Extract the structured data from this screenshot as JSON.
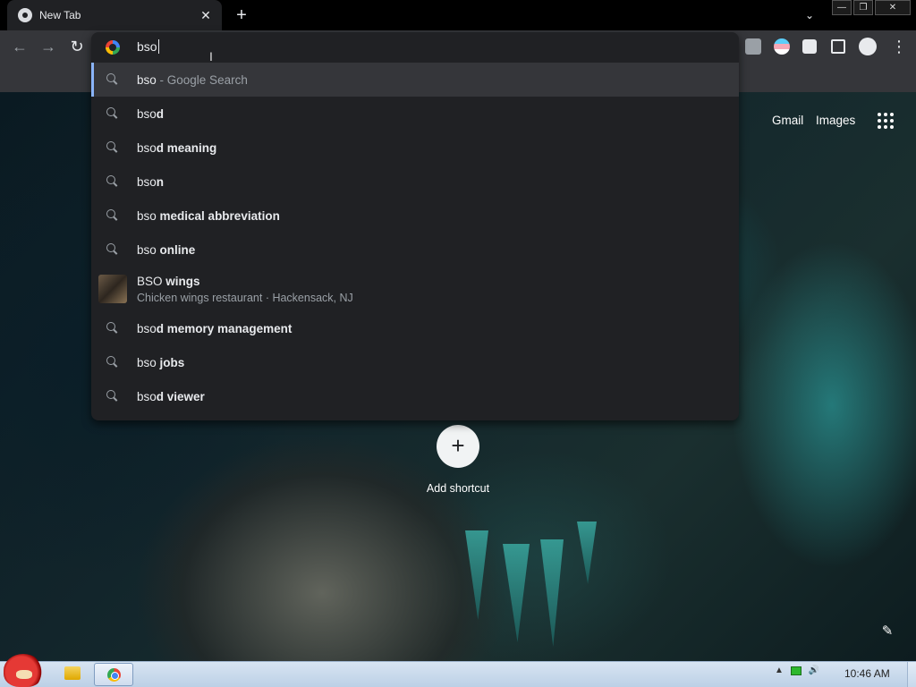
{
  "browser": {
    "tab": {
      "title": "New Tab",
      "close_glyph": "✕",
      "icon": "chrome-icon"
    },
    "new_tab_glyph": "+",
    "tab_search_glyph": "⌄",
    "window_controls": [
      "—",
      "❐",
      "✕"
    ],
    "nav": {
      "back_glyph": "←",
      "forward_glyph": "→",
      "reload_glyph": "↻"
    },
    "extensions": [
      "ublock-icon",
      "extension-avatar-icon",
      "puzzle-icon",
      "sidepanel-icon",
      "profile-icon",
      "menu-dots-icon"
    ],
    "menu_glyph": "⋮"
  },
  "omnibox": {
    "value": "bso",
    "suggestions": [
      {
        "typed": "bso",
        "rest": "",
        "muted": " - Google Search",
        "selected": true
      },
      {
        "typed": "bso",
        "rest": "d"
      },
      {
        "typed": "bso",
        "rest": "d meaning"
      },
      {
        "typed": "bso",
        "rest": "n"
      },
      {
        "typed": "bso ",
        "rest": "medical abbreviation"
      },
      {
        "typed": "bso ",
        "rest": "online"
      },
      {
        "typed": "BSO ",
        "rest": "wings",
        "subtitle": "Chicken wings restaurant · Hackensack, NJ",
        "rich": true
      },
      {
        "typed": "bso",
        "rest": "d memory management"
      },
      {
        "typed": "bso ",
        "rest": "jobs"
      },
      {
        "typed": "bso",
        "rest": "d viewer"
      }
    ]
  },
  "page": {
    "links": {
      "gmail": "Gmail",
      "images": "Images"
    },
    "add_shortcut": {
      "glyph": "+",
      "label": "Add shortcut"
    },
    "edit_glyph": "✎"
  },
  "taskbar": {
    "tray_arrow": "▲",
    "volume_glyph": "🔊",
    "clock": "10:46 AM"
  },
  "colors": {
    "accent": "#8ab4f8",
    "omnibox_bg": "#202124",
    "toolbar_bg": "#35363a"
  }
}
